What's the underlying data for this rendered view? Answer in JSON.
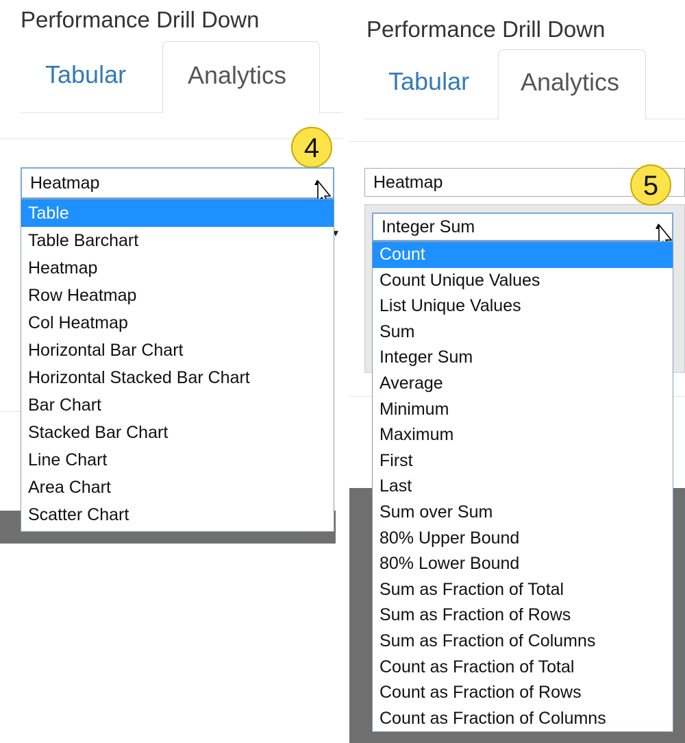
{
  "left": {
    "title": "Performance Drill Down",
    "tabs": [
      "Tabular",
      "Analytics"
    ],
    "badge": "4",
    "renderer_select": {
      "value": "Heatmap",
      "options": [
        "Table",
        "Table Barchart",
        "Heatmap",
        "Row Heatmap",
        "Col Heatmap",
        "Horizontal Bar Chart",
        "Horizontal Stacked Bar Chart",
        "Bar Chart",
        "Stacked Bar Chart",
        "Line Chart",
        "Area Chart",
        "Scatter Chart"
      ],
      "highlighted": "Table"
    }
  },
  "right": {
    "title": "Performance Drill Down",
    "tabs": [
      "Tabular",
      "Analytics"
    ],
    "badge": "5",
    "renderer_select": {
      "value": "Heatmap"
    },
    "aggregator_select": {
      "value": "Integer Sum",
      "options": [
        "Count",
        "Count Unique Values",
        "List Unique Values",
        "Sum",
        "Integer Sum",
        "Average",
        "Minimum",
        "Maximum",
        "First",
        "Last",
        "Sum over Sum",
        "80% Upper Bound",
        "80% Lower Bound",
        "Sum as Fraction of Total",
        "Sum as Fraction of Rows",
        "Sum as Fraction of Columns",
        "Count as Fraction of Total",
        "Count as Fraction of Rows",
        "Count as Fraction of Columns"
      ],
      "highlighted": "Count"
    }
  },
  "colors": {
    "accent": "#1e90ff",
    "link": "#337ab7",
    "badge": "#fde34a",
    "backdrop": "#6f6f6f"
  },
  "icons": [
    "cursor-pointer-icon",
    "dropdown-arrow-icon"
  ]
}
